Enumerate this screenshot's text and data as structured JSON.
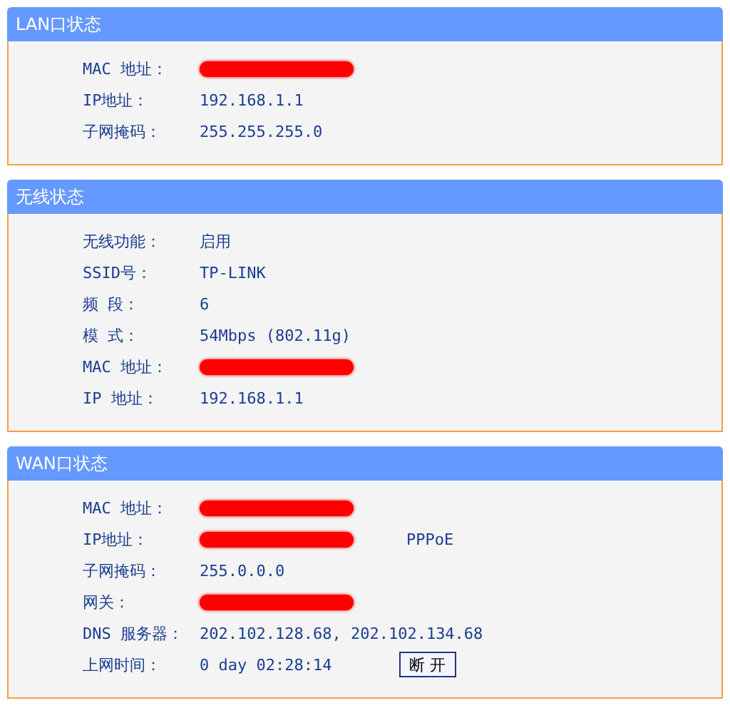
{
  "panels": [
    {
      "title": "LAN口状态",
      "rows": [
        {
          "label": "MAC 地址：",
          "kind": "redacted"
        },
        {
          "label": "IP地址：",
          "kind": "text",
          "value": "192.168.1.1"
        },
        {
          "label": "子网掩码：",
          "kind": "text",
          "value": "255.255.255.0"
        }
      ]
    },
    {
      "title": "无线状态",
      "rows": [
        {
          "label": "无线功能：",
          "kind": "text",
          "value": "启用"
        },
        {
          "label": "SSID号：",
          "kind": "text",
          "value": "TP-LINK"
        },
        {
          "label": "频 段：",
          "kind": "text",
          "value": "6"
        },
        {
          "label": "模 式：",
          "kind": "text",
          "value": "54Mbps (802.11g)"
        },
        {
          "label": "MAC 地址：",
          "kind": "redacted"
        },
        {
          "label": "IP 地址：",
          "kind": "text",
          "value": "192.168.1.1"
        }
      ]
    },
    {
      "title": "WAN口状态",
      "rows": [
        {
          "label": "MAC 地址：",
          "kind": "redacted"
        },
        {
          "label": "IP地址：",
          "kind": "redacted",
          "extra": "PPPoE"
        },
        {
          "label": "子网掩码：",
          "kind": "text",
          "value": "255.0.0.0"
        },
        {
          "label": "网关：",
          "kind": "redacted"
        },
        {
          "label": "DNS 服务器：",
          "kind": "text",
          "value": "202.102.128.68, 202.102.134.68"
        },
        {
          "label": "上网时间：",
          "kind": "text",
          "value": "0 day 02:28:14",
          "button": "断 开"
        }
      ]
    }
  ]
}
